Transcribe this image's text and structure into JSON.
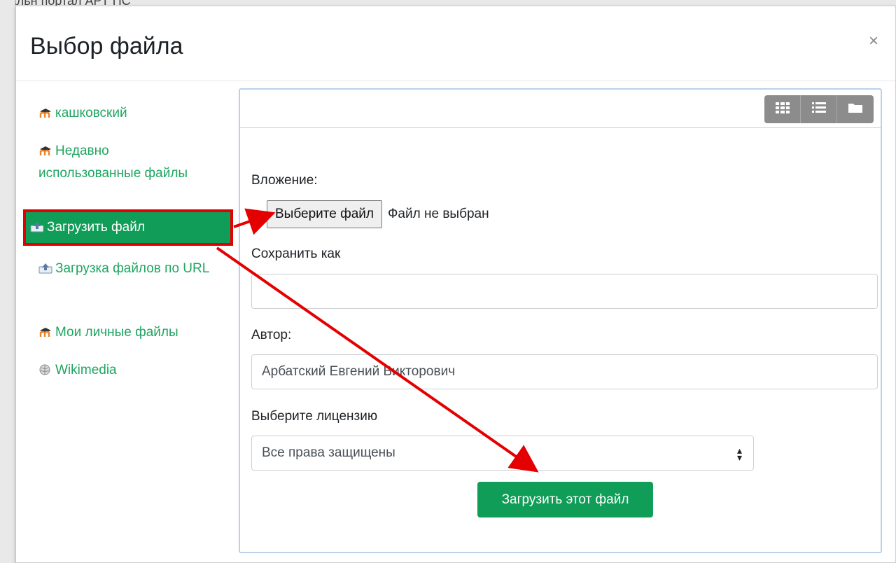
{
  "background": {
    "title_fragment": "пальн портал АРТ ПС"
  },
  "dialog": {
    "title": "Выбор файла",
    "close_label": "×"
  },
  "sidebar": {
    "items": [
      {
        "label": "кашковский",
        "icon": "moodle-icon",
        "active": false
      },
      {
        "label": "Недавно использованные файлы",
        "icon": "moodle-icon",
        "active": false
      },
      {
        "label": "Загрузить файл",
        "icon": "upload-icon",
        "active": true
      },
      {
        "label": "Загрузка файлов по URL",
        "icon": "upload-icon",
        "active": false
      },
      {
        "label": "Мои личные файлы",
        "icon": "moodle-icon",
        "active": false
      },
      {
        "label": "Wikimedia",
        "icon": "wikimedia-icon",
        "active": false
      }
    ]
  },
  "toolbar": {
    "view_icons": [
      "grid-view-icon",
      "list-view-icon",
      "folder-view-icon"
    ]
  },
  "form": {
    "attachment_label": "Вложение:",
    "choose_file_button": "Выберите файл",
    "file_status": "Файл не выбран",
    "save_as_label": "Сохранить как",
    "save_as_value": "",
    "author_label": "Автор:",
    "author_value": "Арбатский Евгений Викторович",
    "license_label": "Выберите лицензию",
    "license_value": "Все права защищены",
    "submit_button": "Загрузить этот файл"
  },
  "colors": {
    "accent": "#0f9d58",
    "link": "#1ea560",
    "highlight_border": "#e40000",
    "annotation_arrow": "#e40000"
  }
}
